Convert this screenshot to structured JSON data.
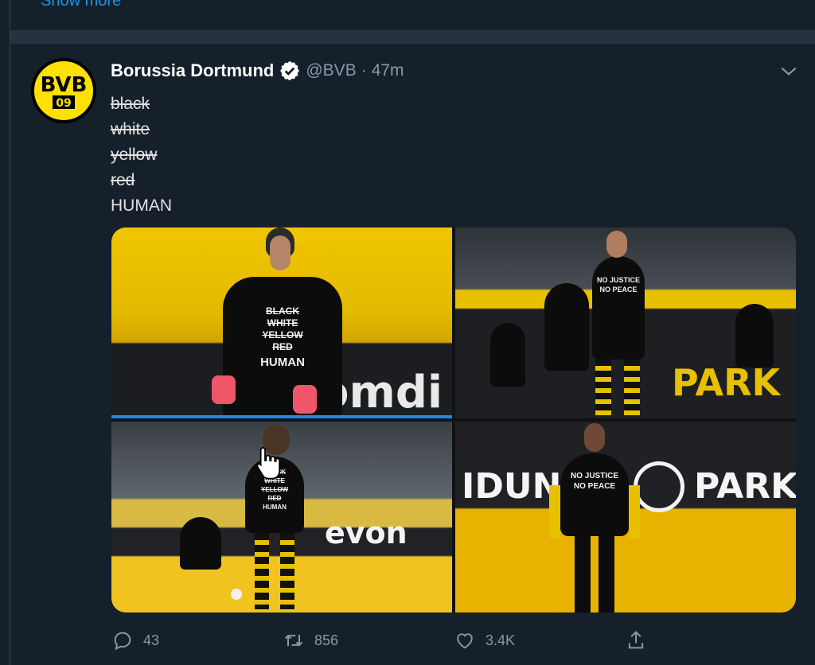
{
  "previous": {
    "show_more": "Show more"
  },
  "tweet": {
    "author_name": "Borussia Dortmund",
    "handle": "@BVB",
    "separator": "·",
    "time": "47m",
    "avatar_text": "BVB",
    "avatar_year": "09",
    "lines": [
      "black",
      "white",
      "yellow",
      "red",
      "HUMAN"
    ],
    "photos": {
      "p1_shirt": [
        "BLACK",
        "WHITE",
        "YELLOW",
        "RED",
        "HUMAN"
      ],
      "p1_banner": "omdi",
      "p2_shirt": [
        "NO JUSTICE",
        "NO PEACE"
      ],
      "p2_banner": "PARK",
      "p3_shirt": [
        "BLACK",
        "WHITE",
        "YELLOW",
        "RED",
        "HUMAN"
      ],
      "p3_banner": "evon",
      "p4_shirt": [
        "NO JUSTICE",
        "NO PEACE"
      ],
      "p4_banner": "IDUN",
      "p4_banner2": "PARK"
    },
    "actions": {
      "replies": "43",
      "retweets": "856",
      "likes": "3.4K"
    }
  },
  "colors": {
    "background": "#15202b",
    "accent": "#1b95e0",
    "bvb_yellow": "#fde100"
  },
  "icons": [
    "verified-icon",
    "chevron-down-icon",
    "reply-icon",
    "retweet-icon",
    "like-icon",
    "share-icon",
    "hand-cursor-icon"
  ]
}
